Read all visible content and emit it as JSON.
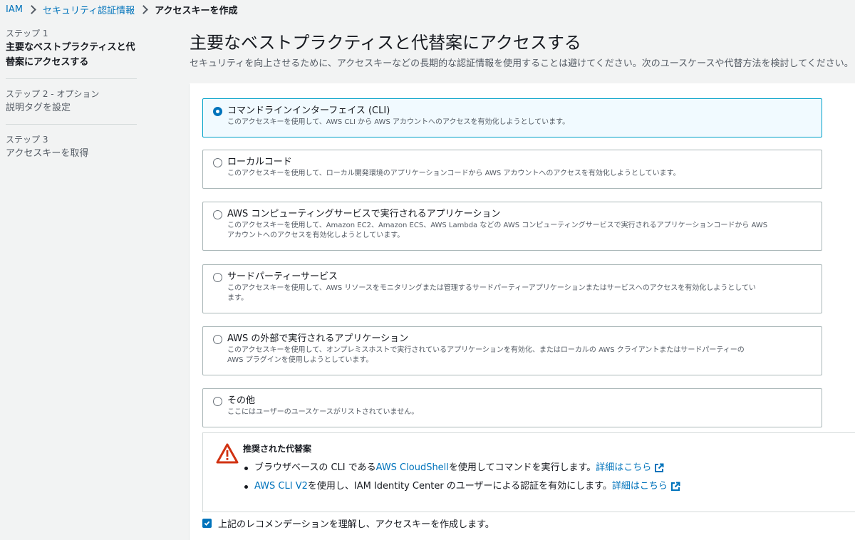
{
  "breadcrumb": {
    "items": [
      "IAM",
      "セキュリティ認証情報"
    ],
    "current": "アクセスキーを作成"
  },
  "steps": [
    {
      "num": "ステップ 1",
      "title_lines": [
        "主要なベストプラクティスと代",
        "替案にアクセスする"
      ]
    },
    {
      "num": "ステップ 2 - オプション",
      "title_lines": [
        "説明タグを設定"
      ]
    },
    {
      "num": "ステップ 3",
      "title_lines": [
        "アクセスキーを取得"
      ]
    }
  ],
  "header": {
    "title": "主要なベストプラクティスと代替案にアクセスする",
    "description": "セキュリティを向上させるために、アクセスキーなどの長期的な認証情報を使用することは避けてください。次のユースケースや代替方法を検討してください。"
  },
  "use_cases": [
    {
      "title": "コマンドラインインターフェイス (CLI)",
      "desc_lines": [
        "このアクセスキーを使用して、AWS CLI から AWS アカウントへのアクセスを有効化しようとしています。"
      ],
      "selected": true
    },
    {
      "title": "ローカルコード",
      "desc_lines": [
        "このアクセスキーを使用して、ローカル開発環境のアプリケーションコードから AWS アカウントへのアクセスを有効化しようとしています。"
      ],
      "selected": false
    },
    {
      "title": "AWS コンピューティングサービスで実行されるアプリケーション",
      "desc_lines": [
        "このアクセスキーを使用して、Amazon EC2、Amazon ECS、AWS Lambda などの AWS コンピューティングサービスで実行されるアプリケーションコードから AWS",
        "アカウントへのアクセスを有効化しようとしています。"
      ],
      "selected": false
    },
    {
      "title": "サードパーティーサービス",
      "desc_lines": [
        "このアクセスキーを使用して、AWS リソースをモニタリングまたは管理するサードパーティーアプリケーションまたはサービスへのアクセスを有効化しようとしてい",
        "ます。"
      ],
      "selected": false
    },
    {
      "title": "AWS の外部で実行されるアプリケーション",
      "desc_lines": [
        "このアクセスキーを使用して、オンプレミスホストで実行されているアプリケーションを有効化、またはローカルの AWS クライアントまたはサードパーティーの",
        "AWS プラグインを使用しようとしています。"
      ],
      "selected": false
    },
    {
      "title": "その他",
      "desc_lines": [
        "ここにはユーザーのユースケースがリストされていません。"
      ],
      "selected": false
    }
  ],
  "alert": {
    "title": "推奨された代替案",
    "items": [
      {
        "before": "ブラウザベースの CLI である ",
        "link": "AWS CloudShell",
        "after": " を使用してコマンドを実行します。 ",
        "more": "詳細はこちら"
      },
      {
        "before": "",
        "link": "AWS CLI V2",
        "after": " を使用し、IAM Identity Center のユーザーによる認証を有効にします。 ",
        "more": "詳細はこちら"
      }
    ]
  },
  "acknowledge": {
    "label": "上記のレコメンデーションを理解し、アクセスキーを作成します。",
    "checked": true
  },
  "colors": {
    "link": "#0073bb",
    "warning": "#d13212",
    "selected_border": "#00a1c9"
  }
}
